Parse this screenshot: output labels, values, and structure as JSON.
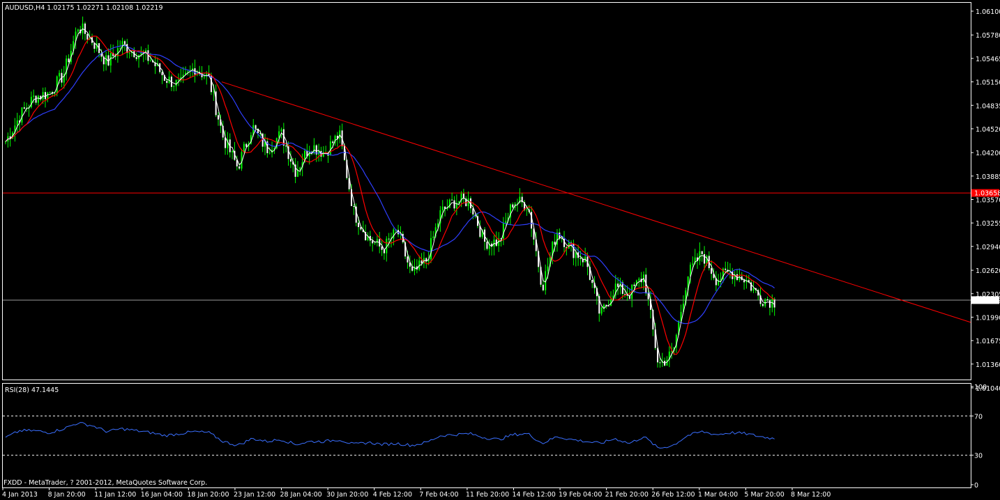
{
  "window": {
    "symbol_header": "AUDUSD,H4  1.02175 1.02271 1.02108 1.02219",
    "rsi_header": "RSI(28) 47.1445",
    "copyright": "FXDD - MetaTrader, ? 2001-2012, MetaQuotes Software Corp."
  },
  "chart_data": {
    "type": "candlestick",
    "symbol": "AUDUSD",
    "timeframe": "H4",
    "ohlc": {
      "open": 1.02175,
      "high": 1.02271,
      "low": 1.02108,
      "close": 1.02219
    },
    "ylim": [
      1.0104,
      1.061
    ],
    "price_ticks": [
      "1.06100",
      "1.05780",
      "1.05465",
      "1.05150",
      "1.04835",
      "1.04520",
      "1.04200",
      "1.03885",
      "1.03570",
      "1.03255",
      "1.02940",
      "1.02620",
      "1.02305",
      "1.01990",
      "1.01675",
      "1.01360",
      "1.01040"
    ],
    "current_price_label": "1.02219",
    "current_price": 1.02219,
    "horizontal_line_label": "1.03658",
    "horizontal_line": 1.03658,
    "x_labels": [
      "4 Jan 2013",
      "8 Jan 20:00",
      "11 Jan 12:00",
      "16 Jan 04:00",
      "18 Jan 20:00",
      "23 Jan 12:00",
      "28 Jan 04:00",
      "30 Jan 20:00",
      "4 Feb 12:00",
      "7 Feb 04:00",
      "11 Feb 20:00",
      "14 Feb 12:00",
      "19 Feb 04:00",
      "21 Feb 20:00",
      "26 Feb 12:00",
      "1 Mar 04:00",
      "5 Mar 20:00",
      "8 Mar 12:00"
    ],
    "price_path": [
      1.0435,
      1.047,
      1.0495,
      1.05,
      1.0525,
      1.059,
      1.057,
      1.054,
      1.0565,
      1.0555,
      1.0545,
      1.052,
      1.051,
      1.0535,
      1.052,
      1.044,
      1.04,
      1.0455,
      1.0425,
      1.0445,
      1.0395,
      1.043,
      1.042,
      1.0445,
      1.034,
      1.0305,
      1.029,
      1.0315,
      1.0255,
      1.0275,
      1.034,
      1.0355,
      1.0355,
      1.03,
      1.03,
      1.0355,
      1.035,
      1.024,
      1.0315,
      1.029,
      1.0275,
      1.02,
      1.024,
      1.023,
      1.0255,
      1.0135,
      1.015,
      1.0255,
      1.0285,
      1.025,
      1.026,
      1.025,
      1.0225,
      1.022
    ],
    "trendline": {
      "from": 1.0515,
      "to": 1.0192
    },
    "rsi": {
      "name": "RSI(28)",
      "last": 47.1445,
      "levels": [
        30,
        70
      ],
      "ticks": [
        "100",
        "70",
        "30",
        "0"
      ],
      "ylim": [
        0,
        100
      ],
      "values": [
        48,
        55,
        55,
        53,
        57,
        63,
        60,
        54,
        57,
        55,
        53,
        50,
        52,
        54,
        53,
        44,
        40,
        47,
        44,
        46,
        41,
        44,
        44,
        46,
        41,
        43,
        41,
        42,
        40,
        43,
        50,
        51,
        52,
        48,
        46,
        51,
        52,
        42,
        49,
        46,
        44,
        42,
        47,
        42,
        49,
        37,
        40,
        50,
        54,
        51,
        53,
        52,
        49,
        47
      ]
    },
    "colors": {
      "background": "#000000",
      "bull_candle": "#00ff00",
      "bear_candle": "#ffffff",
      "fast_ma": "#ff0000",
      "slow_ma": "#2f3fff",
      "close_line": "#ffffff",
      "resistance": "#ff0000",
      "rsi_line": "#3a6fff",
      "axis": "#ffffff"
    }
  }
}
